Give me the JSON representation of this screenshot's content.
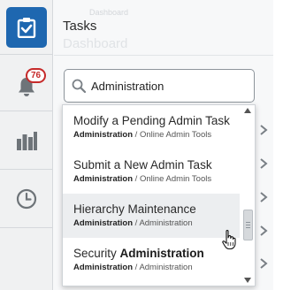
{
  "colors": {
    "accent": "#1e67b0",
    "badge": "#c62a2a",
    "rail_icon": "#6e7479",
    "highlight": "#eceef0"
  },
  "sidebar": {
    "items": [
      {
        "name": "tasks",
        "icon": "clipboard-check-icon",
        "active": true
      },
      {
        "name": "notifications",
        "icon": "bell-icon",
        "badge": "76"
      },
      {
        "name": "analytics",
        "icon": "bar-chart-icon"
      },
      {
        "name": "recent",
        "icon": "clock-icon"
      }
    ]
  },
  "header": {
    "title": "Tasks",
    "ghost_tab": "Dashboard",
    "ghost_title": "Dashboard"
  },
  "search": {
    "icon": "search-icon",
    "value": "Administration"
  },
  "dropdown": {
    "options": [
      {
        "title": "Modify a Pending Admin Task",
        "title_emphasis": "",
        "category": "Administration",
        "subcategory": "Online Admin Tools",
        "highlighted": false
      },
      {
        "title": "Submit a New Admin Task",
        "title_emphasis": "",
        "category": "Administration",
        "subcategory": "Online Admin Tools",
        "highlighted": false
      },
      {
        "title": "Hierarchy Maintenance",
        "title_emphasis": "",
        "category": "Administration",
        "subcategory": "Administration",
        "highlighted": true
      },
      {
        "title": "Security ",
        "title_emphasis": "Administration",
        "category": "Administration",
        "subcategory": "Administration",
        "highlighted": false
      }
    ],
    "separator": " / "
  }
}
